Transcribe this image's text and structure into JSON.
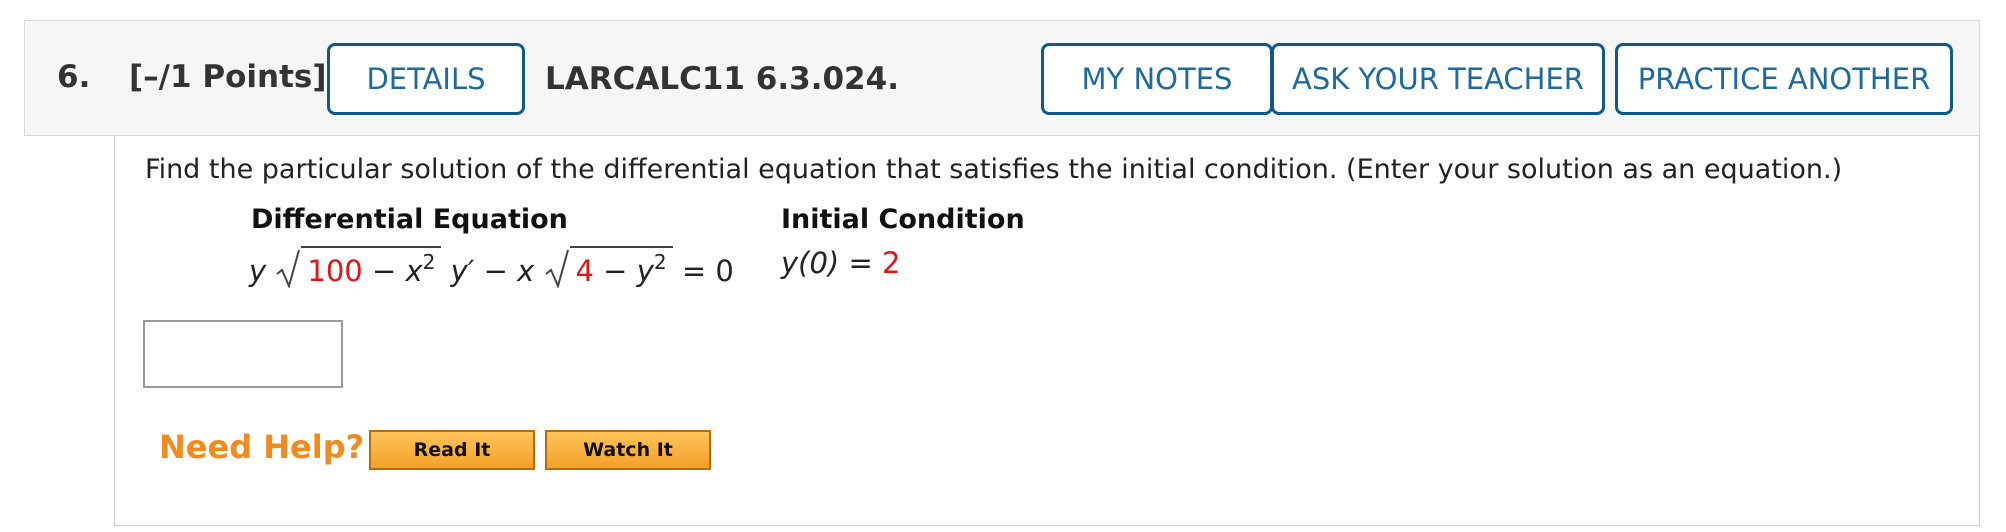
{
  "header": {
    "number": "6.",
    "points": "[–/1 Points]",
    "details_label": "DETAILS",
    "assignment_id": "LARCALC11 6.3.024.",
    "my_notes_label": "MY NOTES",
    "ask_teacher_label": "ASK YOUR TEACHER",
    "practice_label": "PRACTICE ANOTHER"
  },
  "question": {
    "prompt": "Find the particular solution of the differential equation that satisfies the initial condition. (Enter your solution as an equation.)",
    "diff_eq_heading": "Differential Equation",
    "init_cond_heading": "Initial Condition",
    "diff_eq": {
      "y1": "y",
      "const1": "100",
      "minus1": " − ",
      "x2": "x",
      "exp2a": "2",
      "yprime": "y′",
      "minus_mid": " − ",
      "x": "x",
      "const2": "4",
      "minus2": " − ",
      "y2": "y",
      "exp2b": "2",
      "equals": " = 0"
    },
    "init_cond": {
      "lhs": "y(0) = ",
      "value": "2"
    },
    "answer_value": ""
  },
  "help": {
    "label": "Need Help?",
    "read_it": "Read It",
    "watch_it": "Watch It"
  }
}
